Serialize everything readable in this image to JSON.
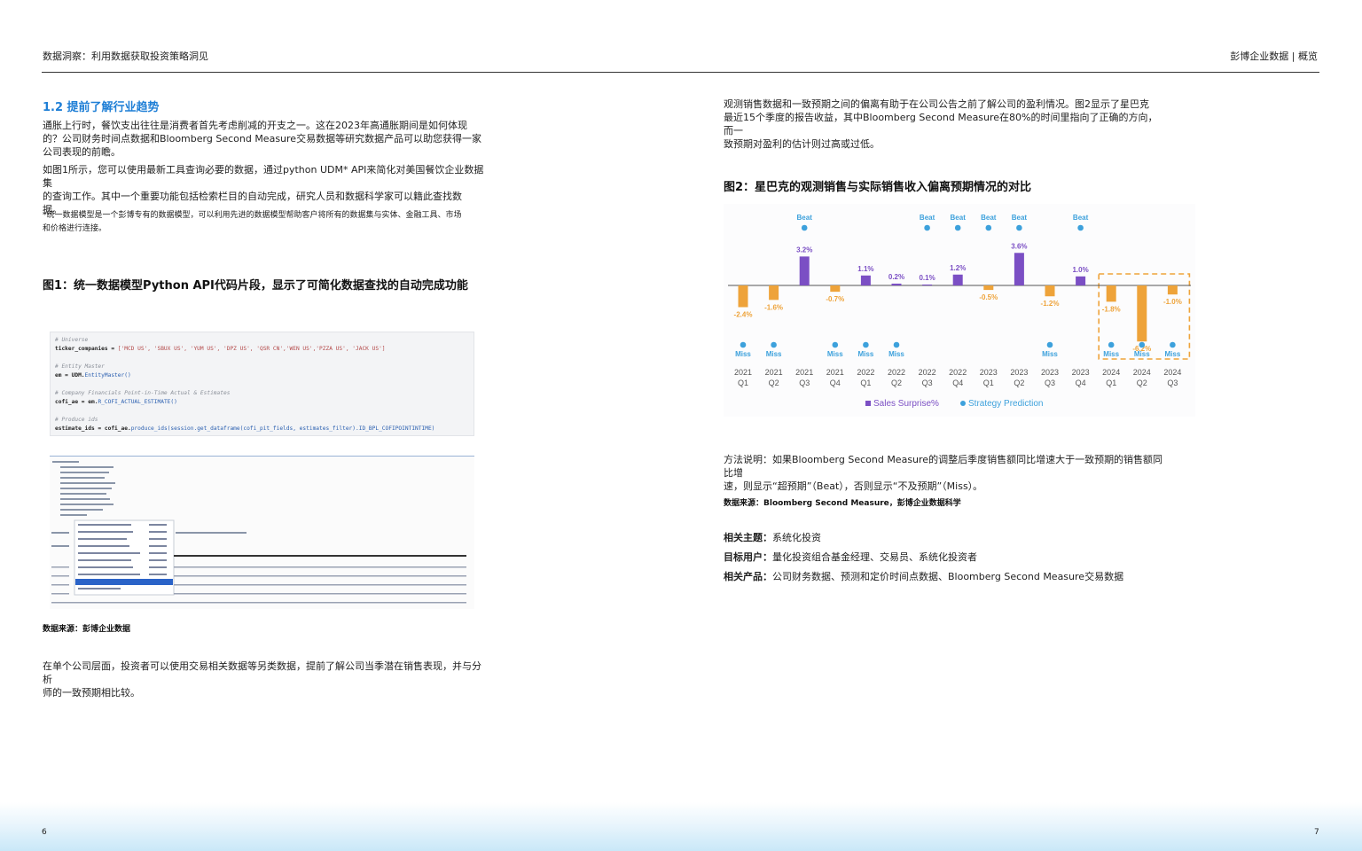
{
  "header": {
    "left_title": "数据洞察：利用数据获取投资策略洞见",
    "right_title": "彭博企业数据 | 概览"
  },
  "left": {
    "section_title": "1.2  提前了解行业趋势",
    "para1": [
      "通胀上行时，餐饮支出往往是消费者首先考虑削减的开支之一。这在2023年高通胀期间是如何体现",
      "的？公司财务时间点数据和Bloomberg Second Measure交易数据等研究数据产品可以助您获得一家",
      "公司表现的前瞻。"
    ],
    "para2": [
      "如图1所示，您可以使用最新工具查询必要的数据，通过python UDM* API来简化对美国餐饮企业数据集",
      "的查询工作。其中一个重要功能包括检索栏目的自动完成，研究人员和数据科学家可以籍此查找数",
      "据。"
    ],
    "footnote": [
      "*统一数据模型是一个彭博专有的数据模型，可以利用先进的数据模型帮助客户将所有的数据集与实体、金融工具、市场",
      "和价格进行连接。"
    ],
    "figure1_title": "图1：统一数据模型Python API代码片段，显示了可简化数据查找的自动完成功能",
    "code": {
      "c1": "# Universe",
      "l1a": "ticker_companies = ",
      "l1b": "['MCD US', 'SBUX US', 'YUM US', 'DPZ US', 'QSR CN','WEN US','PZZA US', 'JACK US']",
      "c2": "# Entity Master",
      "l2a": "em = UDM.",
      "l2b": "EntityMaster()",
      "c3": "# Company Financials Point-in-Time Actual & Estimates",
      "l3a": "cofi_ae = em.",
      "l3b": "R_COFI_ACTUAL_ESTIMATE()",
      "c4": "# Produce ids",
      "l4a": "estimate_ids = cofi_ae.",
      "l4b": "produce_ids(session.get_dataframe(cofi_pit_fields, estimates_filter).ID_BPL_COFIPOINTINTIME)"
    },
    "figure1_source": "数据来源：彭博企业数据",
    "para3": [
      "在单个公司层面，投资者可以使用交易相关数据等另类数据，提前了解公司当季潜在销售表现，并与分析",
      "师的一致预期相比较。"
    ]
  },
  "right": {
    "para1": [
      "观测销售数据和一致预期之间的偏离有助于在公司公告之前了解公司的盈利情况。图2显示了星巴克",
      "最近15个季度的报告收益，其中Bloomberg Second Measure在80%的时间里指向了正确的方向，而一",
      "致预期对盈利的估计则过高或过低。"
    ],
    "figure2_title": "图2：星巴克的观测销售与实际销售收入偏离预期情况的对比",
    "method": [
      "方法说明：如果Bloomberg Second Measure的调整后季度销售额同比增速大于一致预期的销售额同比增",
      "速，则显示“超预期”（Beat），否则显示“不及预期”（Miss）。"
    ],
    "figure2_source": "数据来源：Bloomberg Second Measure，彭博企业数据科学",
    "related_topic_label": "相关主题：",
    "related_topic": "系统化投资",
    "target_users_label": "目标用户：",
    "target_users": "量化投资组合基金经理、交易员、系统化投资者",
    "related_products_label": "相关产品：",
    "related_products": "公司财务数据、预测和定价时间点数据、Bloomberg Second Measure交易数据"
  },
  "page_numbers": {
    "left": "6",
    "right": "7"
  },
  "colors": {
    "purple": "#7b4fc4",
    "orange": "#eea33a",
    "blue": "#3da1dc",
    "title_blue": "#1f7fd6"
  },
  "chart_data": {
    "type": "bar",
    "title": "",
    "xlabel": "",
    "ylabel": "",
    "categories": [
      "2021 Q1",
      "2021 Q2",
      "2021 Q3",
      "2021 Q4",
      "2022 Q1",
      "2022 Q2",
      "2022 Q3",
      "2022 Q4",
      "2023 Q1",
      "2023 Q2",
      "2023 Q3",
      "2023 Q4",
      "2024 Q1",
      "2024 Q2",
      "2024 Q3"
    ],
    "series": [
      {
        "name": "Sales Surprise%",
        "values": [
          -2.4,
          -1.6,
          3.2,
          -0.7,
          1.1,
          0.2,
          0.1,
          1.2,
          -0.5,
          3.6,
          -1.2,
          1.0,
          -1.8,
          -6.2,
          -1.0
        ],
        "labels": [
          "-2.4%",
          "-1.6%",
          "3.2%",
          "-0.7%",
          "1.1%",
          "0.2%",
          "0.1%",
          "1.2%",
          "-0.5%",
          "3.6%",
          "-1.2%",
          "1.0%",
          "-1.8%",
          "-6.2%",
          "-1.0%"
        ]
      },
      {
        "name": "Strategy Prediction",
        "values": [
          "Miss",
          "Miss",
          "Beat",
          "Miss",
          "Miss",
          "Miss",
          "Beat",
          "Beat",
          "Beat",
          "Beat",
          "Miss",
          "Beat",
          "Miss",
          "Miss",
          "Miss"
        ]
      }
    ],
    "highlighted_categories": [
      "2024 Q1",
      "2024 Q2",
      "2024 Q3"
    ],
    "legend_position": "bottom-center",
    "grid": false
  }
}
